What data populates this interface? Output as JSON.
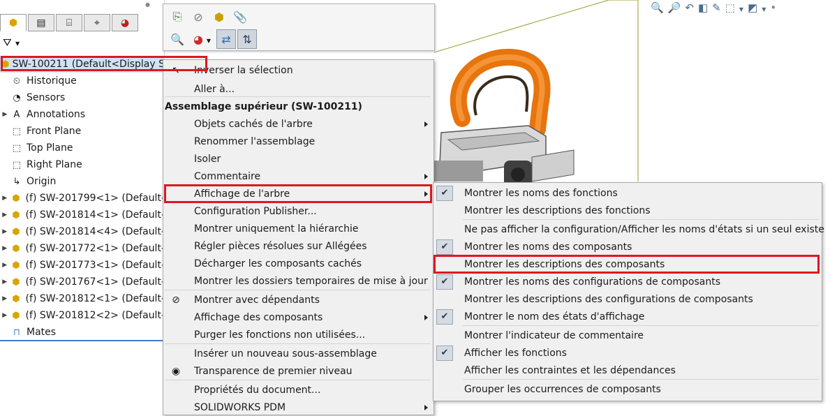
{
  "tree": {
    "root": "SW-100211  (Default<Display S",
    "items": [
      {
        "label": "Historique",
        "icon": "history-icon",
        "expand": false
      },
      {
        "label": "Sensors",
        "icon": "sensors-icon",
        "expand": false
      },
      {
        "label": "Annotations",
        "icon": "annotations-icon",
        "expand": true
      },
      {
        "label": "Front Plane",
        "icon": "plane-icon",
        "expand": false
      },
      {
        "label": "Top Plane",
        "icon": "plane-icon",
        "expand": false
      },
      {
        "label": "Right Plane",
        "icon": "plane-icon",
        "expand": false
      },
      {
        "label": "Origin",
        "icon": "origin-icon",
        "expand": false
      },
      {
        "label": "(f) SW-201799<1> (Default-",
        "icon": "part-icon",
        "expand": true
      },
      {
        "label": "(f) SW-201814<1> (Default-",
        "icon": "part-icon",
        "expand": true
      },
      {
        "label": "(f) SW-201814<4> (Default-",
        "icon": "part-icon",
        "expand": true
      },
      {
        "label": "(f) SW-201772<1> (Default-",
        "icon": "part-icon",
        "expand": true
      },
      {
        "label": "(f) SW-201773<1> (Default-",
        "icon": "part-icon",
        "expand": true
      },
      {
        "label": "(f) SW-201767<1> (Default-",
        "icon": "part-icon",
        "expand": true
      },
      {
        "label": "(f) SW-201812<1> (Default-",
        "icon": "part-icon",
        "expand": true
      },
      {
        "label": "(f) SW-201812<2> (Default-",
        "icon": "part-icon",
        "expand": true
      },
      {
        "label": "Mates",
        "icon": "mates-icon",
        "expand": false
      }
    ]
  },
  "context_menu": {
    "items": [
      {
        "label": "Inverser la sélection",
        "icon": "invert-selection-icon"
      },
      {
        "label": "Aller à..."
      },
      {
        "label": "Assemblage supérieur (SW-100211)",
        "header": true
      },
      {
        "label": "Objets cachés de l'arbre",
        "submenu": true
      },
      {
        "label": "Renommer l'assemblage"
      },
      {
        "label": "Isoler"
      },
      {
        "label": "Commentaire",
        "submenu": true
      },
      {
        "label": "Affichage de l'arbre",
        "submenu": true,
        "highlighted": true
      },
      {
        "label": "Configuration Publisher..."
      },
      {
        "label": "Montrer uniquement la hiérarchie"
      },
      {
        "label": "Régler pièces résolues sur Allégées"
      },
      {
        "label": "Décharger les composants cachés"
      },
      {
        "label": "Montrer les dossiers temporaires de mise à jour"
      },
      {
        "label": "Montrer avec dépendants",
        "icon": "dependents-icon"
      },
      {
        "label": "Affichage des composants",
        "submenu": true
      },
      {
        "label": "Purger les fonctions non utilisées..."
      },
      {
        "label": "Insérer un nouveau sous-assemblage"
      },
      {
        "label": "Transparence de premier niveau",
        "icon": "transparency-icon"
      },
      {
        "label": "Propriétés du document..."
      },
      {
        "label": "SOLIDWORKS PDM",
        "submenu": true
      }
    ]
  },
  "submenu": {
    "items": [
      {
        "label": "Montrer les noms des fonctions",
        "checked": true
      },
      {
        "label": "Montrer les descriptions des fonctions",
        "checked": false
      },
      {
        "label": "Ne pas afficher la configuration/Afficher les noms d'états si un seul existe",
        "checked": false
      },
      {
        "label": "Montrer les noms des composants",
        "checked": true
      },
      {
        "label": "Montrer les descriptions des composants",
        "checked": false,
        "highlighted": true
      },
      {
        "label": "Montrer les noms des configurations de composants",
        "checked": true
      },
      {
        "label": "Montrer les descriptions des configurations de composants",
        "checked": false
      },
      {
        "label": "Montrer le nom des états d'affichage",
        "checked": true
      },
      {
        "label": "Montrer l'indicateur de commentaire",
        "checked": false
      },
      {
        "label": "Afficher les fonctions",
        "checked": true
      },
      {
        "label": "Afficher les contraintes et les dépendances",
        "checked": false
      },
      {
        "label": "Grouper les occurrences de composants",
        "checked": false
      }
    ]
  },
  "colors": {
    "highlight_border": "#e0161f",
    "check_bg": "#d5dbe2",
    "handle_orange": "#f07d10"
  }
}
